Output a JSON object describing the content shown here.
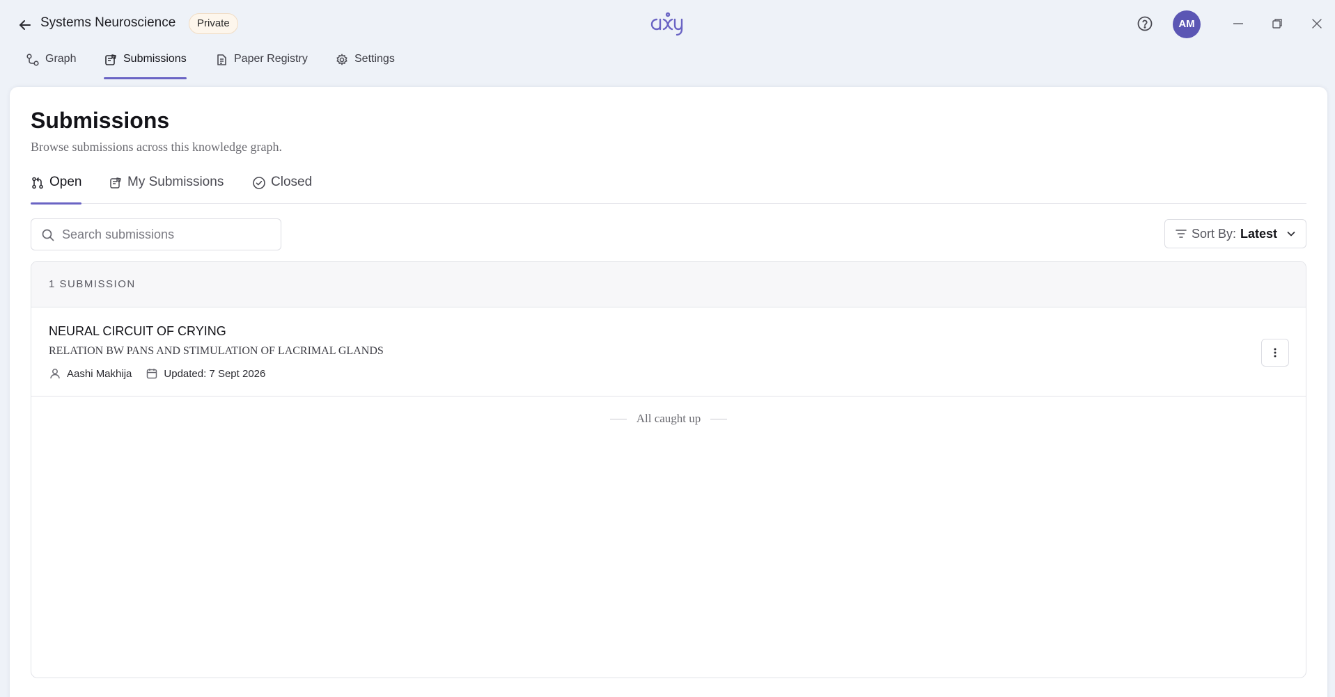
{
  "window": {
    "knowledge_graph": "Systems Neuroscience",
    "visibility_badge": "Private",
    "logo_text": "axy",
    "avatar_initials": "AM",
    "accent_color": "#6a64c4",
    "avatar_color": "#5b56b4"
  },
  "topnav": {
    "items": [
      {
        "label": "Graph",
        "icon": "graph-icon"
      },
      {
        "label": "Submissions",
        "icon": "submissions-icon",
        "active": true
      },
      {
        "label": "Paper Registry",
        "icon": "paper-registry-icon"
      },
      {
        "label": "Settings",
        "icon": "gear-icon"
      }
    ]
  },
  "page": {
    "title": "Submissions",
    "subtitle": "Browse submissions across this knowledge graph."
  },
  "tabs": {
    "items": [
      {
        "label": "Open",
        "icon": "pull-request-icon",
        "active": true
      },
      {
        "label": "My Submissions",
        "icon": "my-submissions-icon"
      },
      {
        "label": "Closed",
        "icon": "check-circle-icon"
      }
    ]
  },
  "search": {
    "placeholder": "Search submissions",
    "value": ""
  },
  "sort": {
    "label": "Sort By:",
    "value": "Latest"
  },
  "list": {
    "count_label": "1 SUBMISSION",
    "items": [
      {
        "title": "NEURAL CIRCUIT OF CRYING",
        "description": "RELATION BW PANS AND STIMULATION OF LACRIMAL GLANDS",
        "author": "Aashi Makhija",
        "updated": "Updated: 7 Sept 2026"
      }
    ],
    "footer": "All caught up"
  }
}
